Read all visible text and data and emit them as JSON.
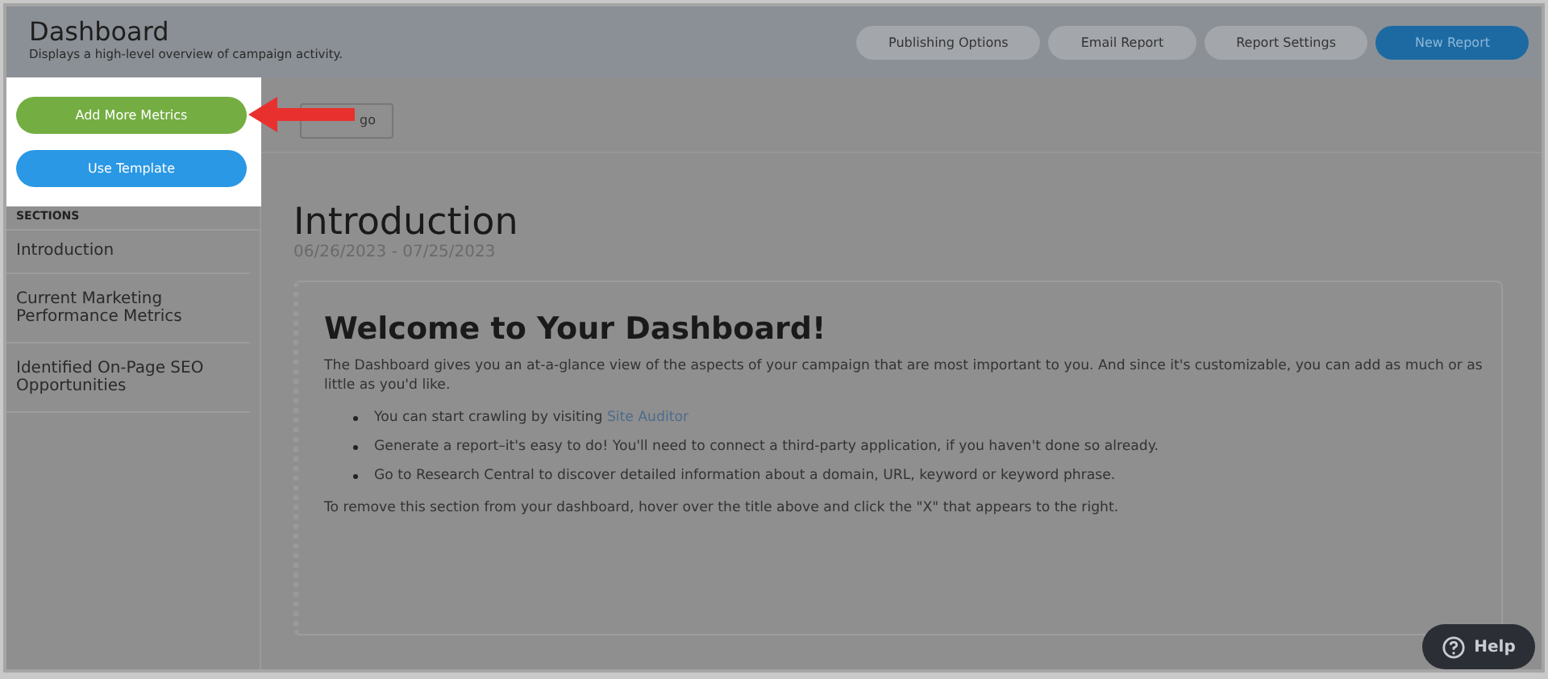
{
  "header": {
    "title": "Dashboard",
    "subtitle": "Displays a high-level overview of campaign activity.",
    "buttons": [
      {
        "label": "Publishing Options",
        "kind": "secondary"
      },
      {
        "label": "Email Report",
        "kind": "secondary"
      },
      {
        "label": "Report Settings",
        "kind": "secondary"
      },
      {
        "label": "New Report",
        "kind": "primary"
      }
    ]
  },
  "actions": [
    {
      "label": "Add More Metrics",
      "kind": "success"
    },
    {
      "label": "Use Template",
      "kind": "info"
    }
  ],
  "toolbar": {
    "button": "go"
  },
  "sidebar": {
    "heading": "SECTIONS",
    "items": [
      {
        "label": "Introduction"
      },
      {
        "label": "Current Marketing Performance Metrics"
      },
      {
        "label": "Identified On-Page SEO Opportunities"
      }
    ]
  },
  "section": {
    "title": "Introduction",
    "dates": "06/26/2023 - 07/25/2023"
  },
  "card": {
    "title": "Welcome to Your Dashboard!",
    "intro": "The Dashboard gives you an at-a-glance view of the aspects of your campaign that are most important to you. And since it's customizable, you can add as much or as little as you'd like.",
    "bullets": [
      {
        "text": "You can start crawling by visiting ",
        "link": "Site Auditor"
      },
      {
        "text": "Generate a report–it's easy to do! You'll need to connect a third-party application, if you haven't done so already."
      },
      {
        "text": "Go to Research Central to discover detailed information about a domain, URL, keyword or keyword phrase."
      }
    ],
    "note": "To remove this section from your dashboard, hover over the title above and click the \"X\" that appears to the right."
  },
  "help": {
    "label": "Help"
  }
}
